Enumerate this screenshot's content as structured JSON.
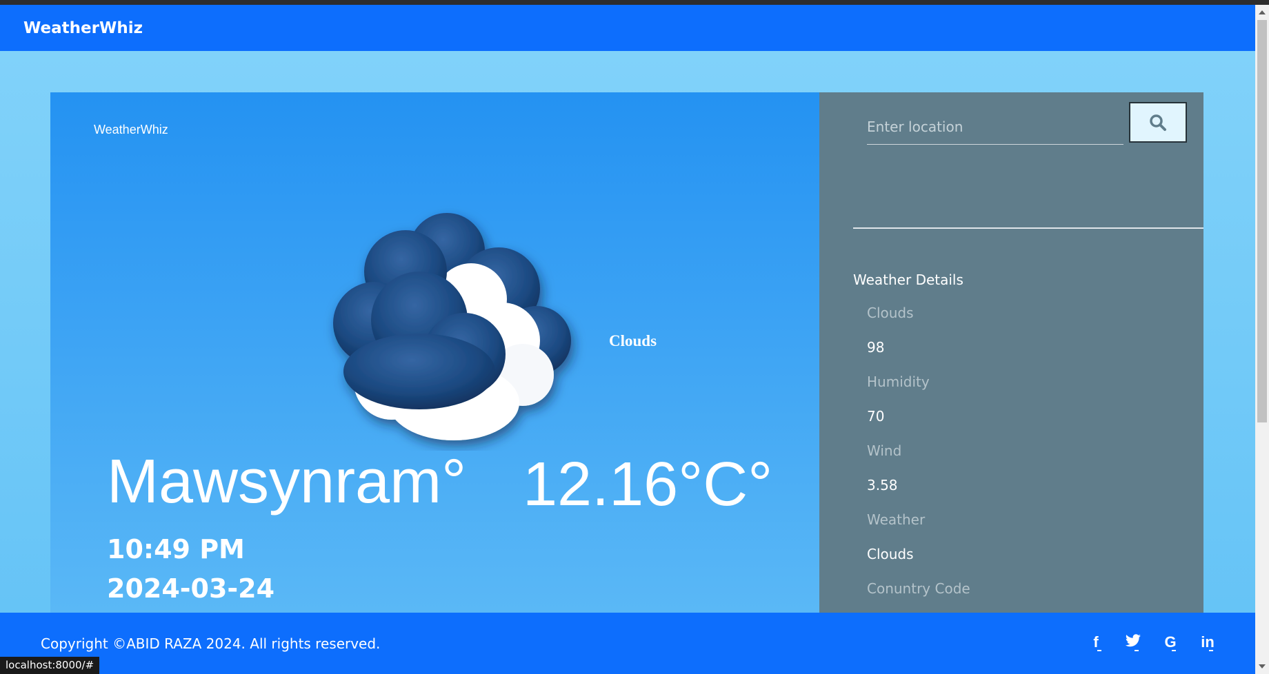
{
  "navbar": {
    "brand": "WeatherWhiz"
  },
  "weather": {
    "brand_small": "WeatherWhiz",
    "condition": "Clouds",
    "city": "Mawsynram°",
    "temperature": "12.16°C°",
    "time": "10:49 PM",
    "date": "2024-03-24",
    "icon": "clouds-icon"
  },
  "search": {
    "placeholder": "Enter location",
    "value": ""
  },
  "details": {
    "title": "Weather Details",
    "items": [
      {
        "label": "Clouds",
        "value": "98"
      },
      {
        "label": "Humidity",
        "value": "70"
      },
      {
        "label": "Wind",
        "value": "3.58"
      },
      {
        "label": "Weather",
        "value": "Clouds"
      },
      {
        "label": "Conuntry Code",
        "value": ""
      }
    ]
  },
  "footer": {
    "copyright": "Copyright ©ABID RAZA 2024. All rights reserved.",
    "socials": [
      {
        "name": "facebook-icon",
        "glyph": "f"
      },
      {
        "name": "twitter-icon",
        "glyph": "t"
      },
      {
        "name": "google-icon",
        "glyph": "G"
      },
      {
        "name": "linkedin-icon",
        "glyph": "in"
      }
    ]
  },
  "status_bar": {
    "url": "localhost:8000/#"
  },
  "colors": {
    "navbar": "#0d6efd",
    "left_panel_top": "#2492f2",
    "right_panel": "#607d8b",
    "page_bg": "#83d3fa"
  }
}
